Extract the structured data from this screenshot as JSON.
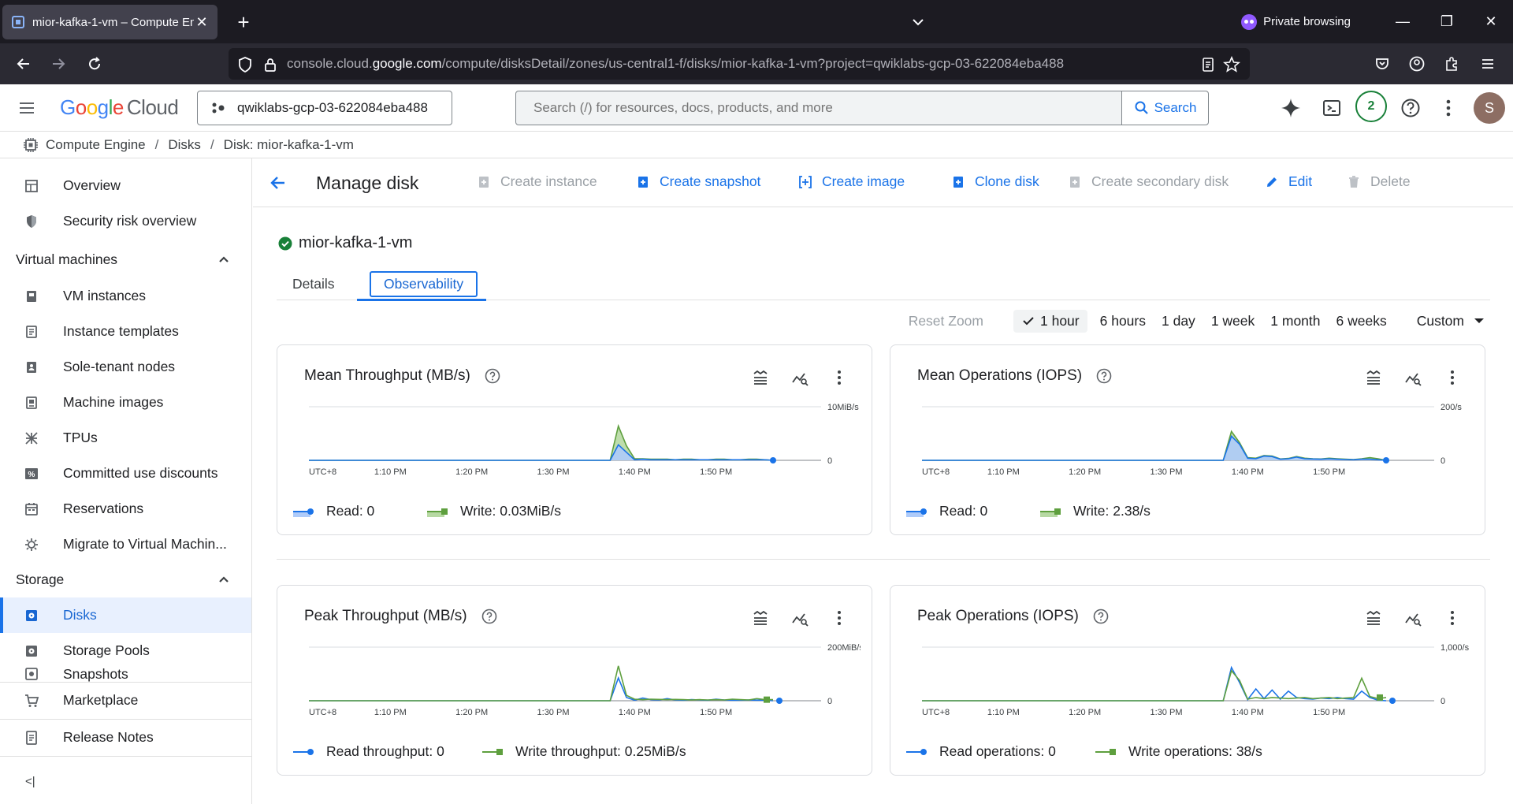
{
  "browser": {
    "tab_title": "mior-kafka-1-vm – Compute En",
    "private_label": "Private browsing",
    "url_prefix": "console.cloud.",
    "url_domain": "google.com",
    "url_path": "/compute/disksDetail/zones/us-central1-f/disks/mior-kafka-1-vm?project=qwiklabs-gcp-03-622084eba488"
  },
  "header": {
    "logo_google": [
      "G",
      "o",
      "o",
      "g",
      "l",
      "e"
    ],
    "logo_cloud": "Cloud",
    "project": "qwiklabs-gcp-03-622084eba488",
    "search_placeholder": "Search (/) for resources, docs, products, and more",
    "search_button": "Search",
    "notifications_count": "2",
    "avatar_initial": "S"
  },
  "breadcrumb": [
    "Compute Engine",
    "Disks",
    "Disk: mior-kafka-1-vm"
  ],
  "sidebar": {
    "top_items": [
      "Overview",
      "Security risk overview"
    ],
    "vm_section": "Virtual machines",
    "vm_items": [
      "VM instances",
      "Instance templates",
      "Sole-tenant nodes",
      "Machine images",
      "TPUs",
      "Committed use discounts",
      "Reservations",
      "Migrate to Virtual Machin..."
    ],
    "storage_section": "Storage",
    "storage_items": [
      "Disks",
      "Storage Pools",
      "Snapshots"
    ],
    "bottom_items": [
      "Marketplace",
      "Release Notes"
    ],
    "collapse_label": "<|"
  },
  "toolbar": {
    "title": "Manage disk",
    "create_instance": "Create instance",
    "create_snapshot": "Create snapshot",
    "create_image": "Create image",
    "clone_disk": "Clone disk",
    "create_secondary": "Create secondary disk",
    "edit": "Edit",
    "delete": "Delete"
  },
  "disk_name": "mior-kafka-1-vm",
  "tabs": [
    "Details",
    "Observability"
  ],
  "time_range": {
    "reset": "Reset Zoom",
    "options": [
      "1 hour",
      "6 hours",
      "1 day",
      "1 week",
      "1 month",
      "6 weeks"
    ],
    "selected": "1 hour",
    "custom": "Custom"
  },
  "colors": {
    "read": "#1a73e8",
    "write": "#5e9f3e",
    "accent": "#1a73e8"
  },
  "chart_data": [
    {
      "type": "area",
      "title": "Mean Throughput (MB/s)",
      "x_ticks": [
        "UTC+8",
        "1:10 PM",
        "1:20 PM",
        "1:30 PM",
        "1:40 PM",
        "1:50 PM"
      ],
      "y_ticks": [
        "10MiB/s",
        "0"
      ],
      "ylim": [
        0,
        10
      ],
      "x": [
        0,
        5,
        10,
        15,
        20,
        25,
        30,
        35,
        37,
        38,
        39,
        40,
        41,
        42,
        43,
        44,
        45,
        46,
        47,
        48,
        49,
        50,
        51,
        52,
        53,
        54,
        55,
        56,
        57
      ],
      "series": [
        {
          "name": "Read",
          "legend": "Read: 0",
          "values": [
            0,
            0,
            0,
            0,
            0,
            0,
            0,
            0,
            0,
            2.9,
            1.5,
            0.1,
            0.2,
            0.1,
            0.1,
            0.1,
            0.1,
            0.1,
            0.1,
            0.1,
            0.1,
            0.1,
            0.1,
            0.1,
            0.1,
            0.1,
            0.1,
            0.1,
            0
          ]
        },
        {
          "name": "Write",
          "legend": "Write: 0.03MiB/s",
          "values": [
            0,
            0,
            0,
            0,
            0,
            0,
            0,
            0,
            0,
            6.4,
            2.7,
            0.3,
            0.3,
            0.2,
            0.2,
            0.2,
            0.1,
            0.2,
            0.2,
            0.1,
            0.1,
            0.2,
            0.2,
            0.1,
            0.1,
            0.2,
            0.2,
            0.1,
            0
          ]
        }
      ]
    },
    {
      "type": "area",
      "title": "Mean Operations (IOPS)",
      "x_ticks": [
        "UTC+8",
        "1:10 PM",
        "1:20 PM",
        "1:30 PM",
        "1:40 PM",
        "1:50 PM"
      ],
      "y_ticks": [
        "200/s",
        "0"
      ],
      "ylim": [
        0,
        200
      ],
      "x": [
        0,
        5,
        10,
        15,
        20,
        25,
        30,
        35,
        37,
        38,
        39,
        40,
        41,
        42,
        43,
        44,
        45,
        46,
        47,
        48,
        49,
        50,
        51,
        52,
        53,
        54,
        55,
        56,
        57
      ],
      "series": [
        {
          "name": "Read",
          "legend": "Read: 0",
          "values": [
            0,
            0,
            0,
            0,
            0,
            0,
            0,
            0,
            0,
            90,
            60,
            8,
            6,
            16,
            14,
            4,
            6,
            12,
            6,
            5,
            4,
            6,
            4,
            3,
            2,
            4,
            4,
            2,
            0
          ]
        },
        {
          "name": "Write",
          "legend": "Write: 2.38/s",
          "values": [
            0,
            0,
            0,
            0,
            0,
            0,
            0,
            0,
            0,
            108,
            66,
            10,
            8,
            18,
            16,
            5,
            7,
            14,
            8,
            6,
            5,
            8,
            6,
            4,
            3,
            6,
            10,
            6,
            0
          ]
        }
      ]
    },
    {
      "type": "line",
      "title": "Peak Throughput (MB/s)",
      "x_ticks": [
        "UTC+8",
        "1:10 PM",
        "1:20 PM",
        "1:30 PM",
        "1:40 PM",
        "1:50 PM"
      ],
      "y_ticks": [
        "200MiB/s",
        "0"
      ],
      "ylim": [
        0,
        200
      ],
      "x": [
        0,
        5,
        10,
        15,
        20,
        25,
        30,
        35,
        37,
        38,
        39,
        40,
        41,
        42,
        43,
        44,
        45,
        46,
        47,
        48,
        49,
        50,
        51,
        52,
        53,
        54,
        55,
        56,
        57
      ],
      "series": [
        {
          "name": "Read throughput",
          "legend": "Read throughput: 0",
          "values": [
            0,
            0,
            0,
            0,
            0,
            0,
            0,
            0,
            0,
            85,
            12,
            2,
            10,
            4,
            3,
            8,
            3,
            2,
            4,
            3,
            2,
            6,
            3,
            2,
            2,
            3,
            2,
            2,
            0
          ]
        },
        {
          "name": "Write throughput",
          "legend": "Write throughput: 0.25MiB/s",
          "values": [
            0,
            0,
            0,
            0,
            0,
            0,
            0,
            0,
            0,
            130,
            20,
            6,
            4,
            6,
            5,
            4,
            5,
            4,
            3,
            4,
            3,
            4,
            3,
            6,
            4,
            3,
            8,
            4,
            4
          ]
        }
      ]
    },
    {
      "type": "line",
      "title": "Peak Operations (IOPS)",
      "x_ticks": [
        "UTC+8",
        "1:10 PM",
        "1:20 PM",
        "1:30 PM",
        "1:40 PM",
        "1:50 PM"
      ],
      "y_ticks": [
        "1,000/s",
        "0"
      ],
      "ylim": [
        0,
        1000
      ],
      "x": [
        0,
        5,
        10,
        15,
        20,
        25,
        30,
        35,
        37,
        38,
        39,
        40,
        41,
        42,
        43,
        44,
        45,
        46,
        47,
        48,
        49,
        50,
        51,
        52,
        53,
        54,
        55,
        56,
        57
      ],
      "series": [
        {
          "name": "Read operations",
          "legend": "Read operations: 0",
          "values": [
            0,
            0,
            0,
            0,
            0,
            0,
            0,
            0,
            0,
            620,
            340,
            20,
            220,
            40,
            200,
            30,
            180,
            60,
            40,
            30,
            50,
            40,
            60,
            40,
            30,
            180,
            60,
            10,
            0
          ]
        },
        {
          "name": "Write operations",
          "legend": "Write operations: 38/s",
          "values": [
            0,
            0,
            0,
            0,
            0,
            0,
            0,
            0,
            0,
            560,
            380,
            30,
            60,
            40,
            60,
            50,
            40,
            50,
            60,
            40,
            50,
            60,
            40,
            50,
            60,
            420,
            80,
            40,
            60
          ]
        }
      ]
    }
  ]
}
